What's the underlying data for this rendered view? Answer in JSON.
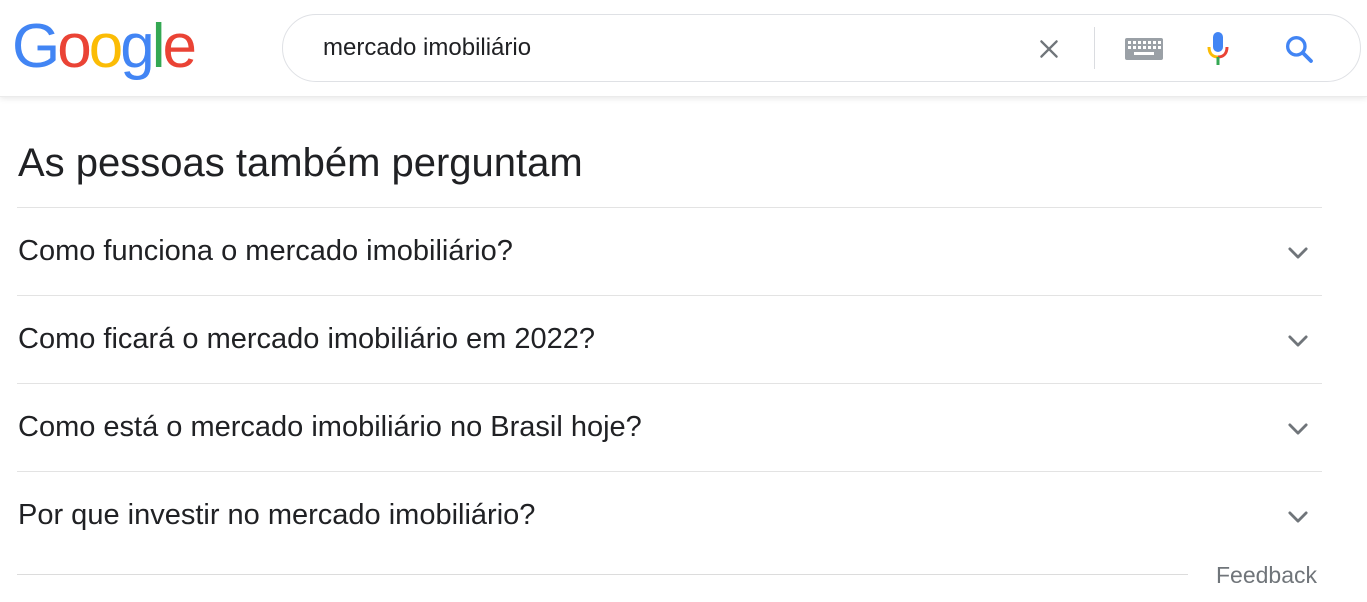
{
  "logo": {
    "letters": [
      "G",
      "o",
      "o",
      "g",
      "l",
      "e"
    ],
    "colors": [
      "#4285F4",
      "#EA4335",
      "#FBBC05",
      "#4285F4",
      "#34A853",
      "#EA4335"
    ]
  },
  "search": {
    "query": "mercado imobiliário",
    "icons": [
      "close-icon",
      "keyboard-icon",
      "mic-icon",
      "search-icon"
    ]
  },
  "paa": {
    "title": "As pessoas também perguntam",
    "questions": [
      "Como funciona o mercado imobiliário?",
      "Como ficará o mercado imobiliário em 2022?",
      "Como está o mercado imobiliário no Brasil hoje?",
      "Por que investir no mercado imobiliário?"
    ]
  },
  "footer": {
    "feedback": "Feedback"
  },
  "colors": {
    "text": "#202124",
    "secondary": "#70757a",
    "blue": "#4285F4"
  }
}
